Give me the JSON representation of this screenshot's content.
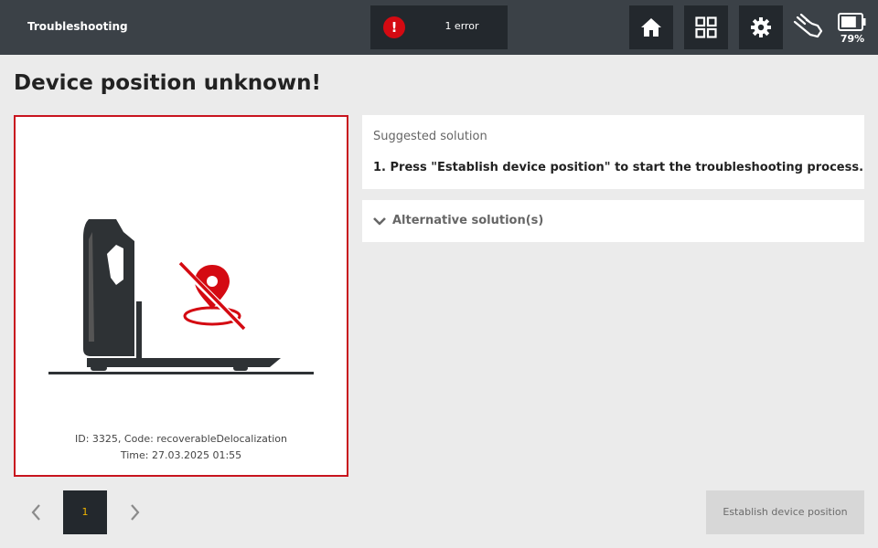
{
  "header": {
    "title": "Troubleshooting",
    "error_indicator": {
      "icon": "exclamation-icon",
      "text": "1 error",
      "color": "#d40a12"
    },
    "nav_buttons": [
      {
        "name": "home-icon"
      },
      {
        "name": "grid-icon"
      },
      {
        "name": "gear-icon"
      }
    ],
    "manual_mode_icon": "hand-icon",
    "battery": {
      "icon": "battery-icon",
      "percent_label": "79%",
      "level": 0.79
    }
  },
  "page": {
    "title": "Device position unknown!"
  },
  "error_card": {
    "illustration": "pallet-truck-with-crossed-location-pin",
    "id_code": "ID: 3325, Code: recoverableDelocalization",
    "time": "Time: 27.03.2025 01:55",
    "border_color": "#c8141e"
  },
  "suggested_solution": {
    "heading": "Suggested solution",
    "steps": [
      "1. Press \"Establish device position\" to start the troubleshooting process."
    ]
  },
  "alternative_solutions": {
    "label": "Alternative solution(s)",
    "expanded": false,
    "icon": "chevron-down-icon"
  },
  "pagination": {
    "current_page": "1",
    "prev_icon": "chevron-left-icon",
    "next_icon": "chevron-right-icon"
  },
  "actions": {
    "establish_label": "Establish device position",
    "establish_enabled": false
  },
  "colors": {
    "topbar": "#3b4147",
    "button_dark": "#23282d",
    "accent_red": "#d40a12",
    "page_indicator": "#f0b400"
  }
}
